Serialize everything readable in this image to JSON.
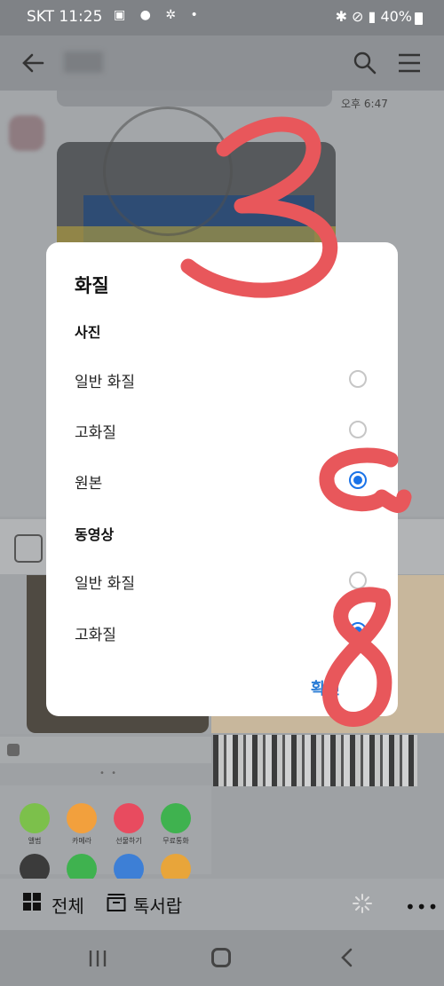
{
  "status_bar": {
    "carrier_time": "SKT 11:25",
    "battery": "40%"
  },
  "chat": {
    "time_top": "오후 6:47"
  },
  "dialog": {
    "title": "화질",
    "photo_section": "사진",
    "photo_options": [
      {
        "label": "일반 화질",
        "selected": false
      },
      {
        "label": "고화질",
        "selected": false
      },
      {
        "label": "원본",
        "selected": true
      }
    ],
    "video_section": "동영상",
    "video_options": [
      {
        "label": "일반 화질",
        "selected": false
      },
      {
        "label": "고화질",
        "selected": true
      }
    ],
    "confirm_label": "확인"
  },
  "tray": {
    "items": [
      {
        "label": "앨범",
        "color": "#7cc04b"
      },
      {
        "label": "카메라",
        "color": "#f2a03d"
      },
      {
        "label": "선물하기",
        "color": "#e84b5f"
      },
      {
        "label": "무료통화",
        "color": "#3fb24f"
      }
    ]
  },
  "bottom_bar": {
    "all_label": "전체",
    "inbox_label": "톡서랍"
  },
  "annotations": {
    "color": "#e8575b",
    "numbers": [
      "3",
      "8"
    ]
  },
  "accent_color": "#1a73e8"
}
